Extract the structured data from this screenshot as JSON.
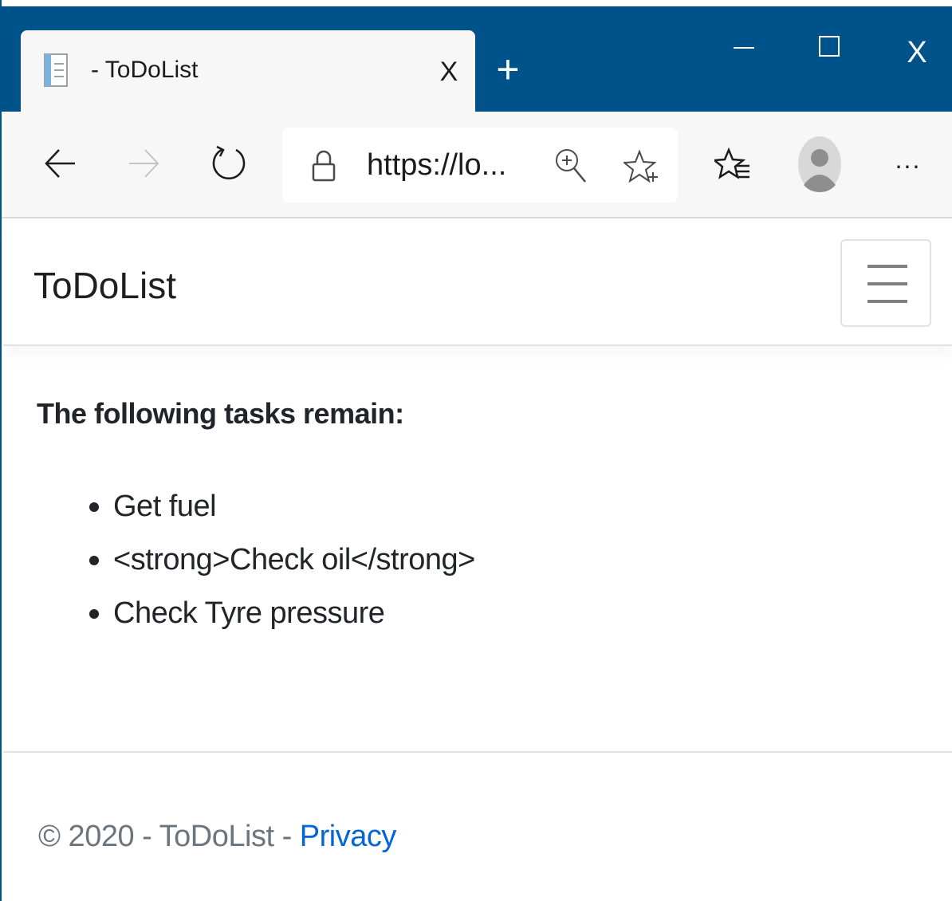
{
  "browser": {
    "tab": {
      "title": "- ToDoList",
      "close_label": "X"
    },
    "new_tab_label": "+",
    "window_controls": {
      "close_label": "X"
    },
    "address_bar": {
      "url": "https://lo..."
    },
    "more_label": "...",
    "icons": [
      "page-favicon-icon",
      "back-arrow-icon",
      "forward-arrow-icon",
      "refresh-icon",
      "lock-icon",
      "zoom-in-icon",
      "add-favorite-star-icon",
      "favorites-icon",
      "profile-avatar-icon",
      "minimize-icon",
      "maximize-icon",
      "hamburger-menu-icon"
    ],
    "colors": {
      "title_bar": "#00528a",
      "toolbar": "#f7f7f7"
    }
  },
  "page": {
    "brand": "ToDoList",
    "heading": "The following tasks remain:",
    "tasks": [
      "Get fuel",
      "<strong>Check oil</strong>",
      "Check Tyre pressure"
    ],
    "footer": {
      "copyright": "© 2020 - ToDoList - ",
      "privacy_link": "Privacy"
    },
    "colors": {
      "link": "#0366d6",
      "muted_text": "#6c757d"
    }
  }
}
